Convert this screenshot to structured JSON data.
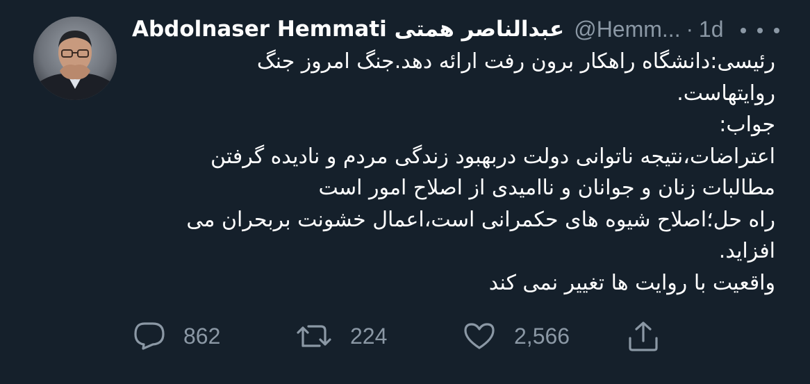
{
  "tweet": {
    "author": {
      "display_name": "Abdolnaser Hemmati عبدالناصر همتی",
      "handle": "@Hemm...",
      "separator": "·",
      "time": "1d"
    },
    "body_lines": [
      "رئیسی:دانشگاه راهکار برون رفت ارائه دهد.جنگ امروز جنگ",
      "روایتهاست.",
      "جواب:",
      "اعتراضات،نتیجه ناتوانی دولت دربهبود زندگی مردم و نادیده گرفتن",
      "مطالبات زنان و جوانان و ناامیدی از اصلاح امور است",
      "راه حل؛اصلاح شیوه های حکمرانی است،اعمال خشونت بربحران می",
      "افزاید.",
      "واقعیت با روایت ها تغییر نمی کند"
    ],
    "actions": {
      "replies": "862",
      "retweets": "224",
      "likes": "2,566"
    },
    "icons": {
      "more": "more-horizontal-icon",
      "reply": "reply-bubble-icon",
      "retweet": "retweet-icon",
      "like": "heart-icon",
      "share": "share-upload-icon"
    },
    "colors": {
      "background": "#15202b",
      "primary_text": "#ffffff",
      "secondary_text": "#8b98a5"
    }
  }
}
